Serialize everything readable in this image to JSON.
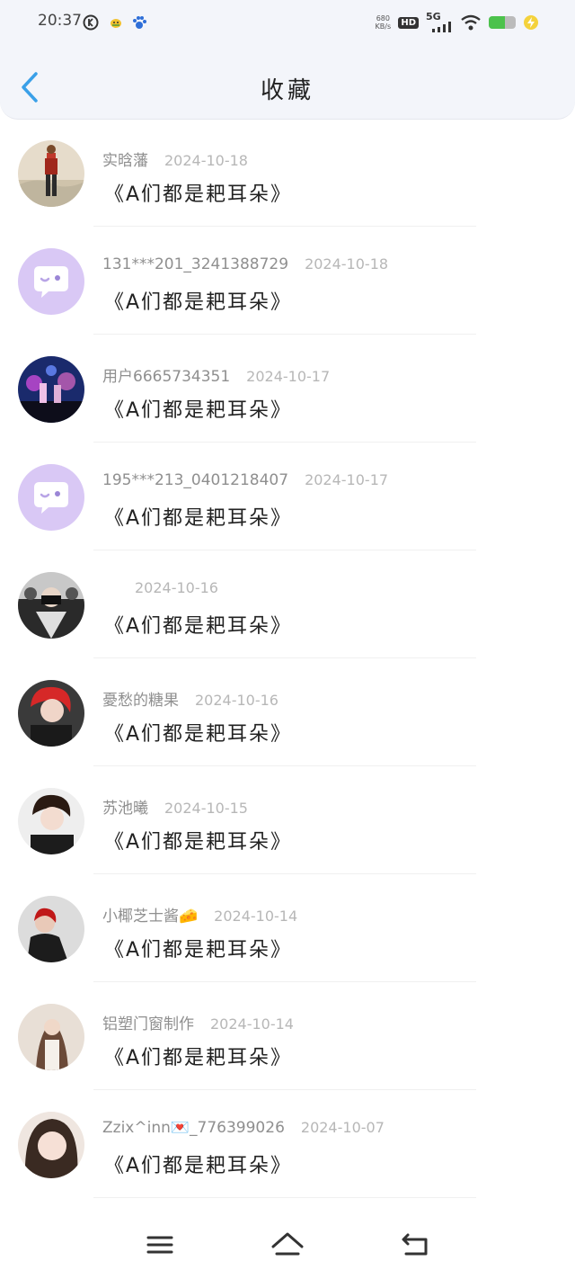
{
  "status": {
    "time": "20:37",
    "net_speed_value": "680",
    "net_speed_unit": "KB/s",
    "hd": "HD",
    "signal": "5G",
    "icons": [
      "k-icon",
      "bee-icon",
      "paw-icon",
      "signal-icon",
      "wifi-icon",
      "battery-icon",
      "charging-icon"
    ]
  },
  "header": {
    "title": "收藏"
  },
  "items": [
    {
      "user": "实晗藩",
      "date": "2024-10-18",
      "title": "《A们都是耙耳朵》",
      "avatar": "photo-person-field"
    },
    {
      "user": "131***201_3241388729",
      "date": "2024-10-18",
      "title": "《A们都是耙耳朵》",
      "avatar": "default-chat-bubble"
    },
    {
      "user": "用户6665734351",
      "date": "2024-10-17",
      "title": "《A们都是耙耳朵》",
      "avatar": "photo-concert-stage"
    },
    {
      "user": "195***213_0401218407",
      "date": "2024-10-17",
      "title": "《A们都是耙耳朵》",
      "avatar": "default-chat-bubble"
    },
    {
      "user": "",
      "date": "2024-10-16",
      "title": "《A们都是耙耳朵》",
      "avatar": "photo-group-masked"
    },
    {
      "user": "憂愁的糖果",
      "date": "2024-10-16",
      "title": "《A们都是耙耳朵》",
      "avatar": "photo-red-hair"
    },
    {
      "user": "苏池曦",
      "date": "2024-10-15",
      "title": "《A们都是耙耳朵》",
      "avatar": "photo-young-man"
    },
    {
      "user": "小椰芝士酱🧀",
      "date": "2024-10-14",
      "title": "《A们都是耙耳朵》",
      "avatar": "photo-dark-portrait"
    },
    {
      "user": "铝塑门窗制作",
      "date": "2024-10-14",
      "title": "《A们都是耙耳朵》",
      "avatar": "photo-girl-long-hair"
    },
    {
      "user": "Zzix^inn💌_776399026",
      "date": "2024-10-07",
      "title": "《A们都是耙耳朵》",
      "avatar": "photo-girl-closeup"
    }
  ],
  "nav": {
    "icons": [
      "menu-icon",
      "home-icon",
      "return-icon"
    ]
  },
  "colors": {
    "accent": "#3aa0e8",
    "header_bg": "#f3f5fa",
    "default_avatar": "#d9c8f5"
  }
}
